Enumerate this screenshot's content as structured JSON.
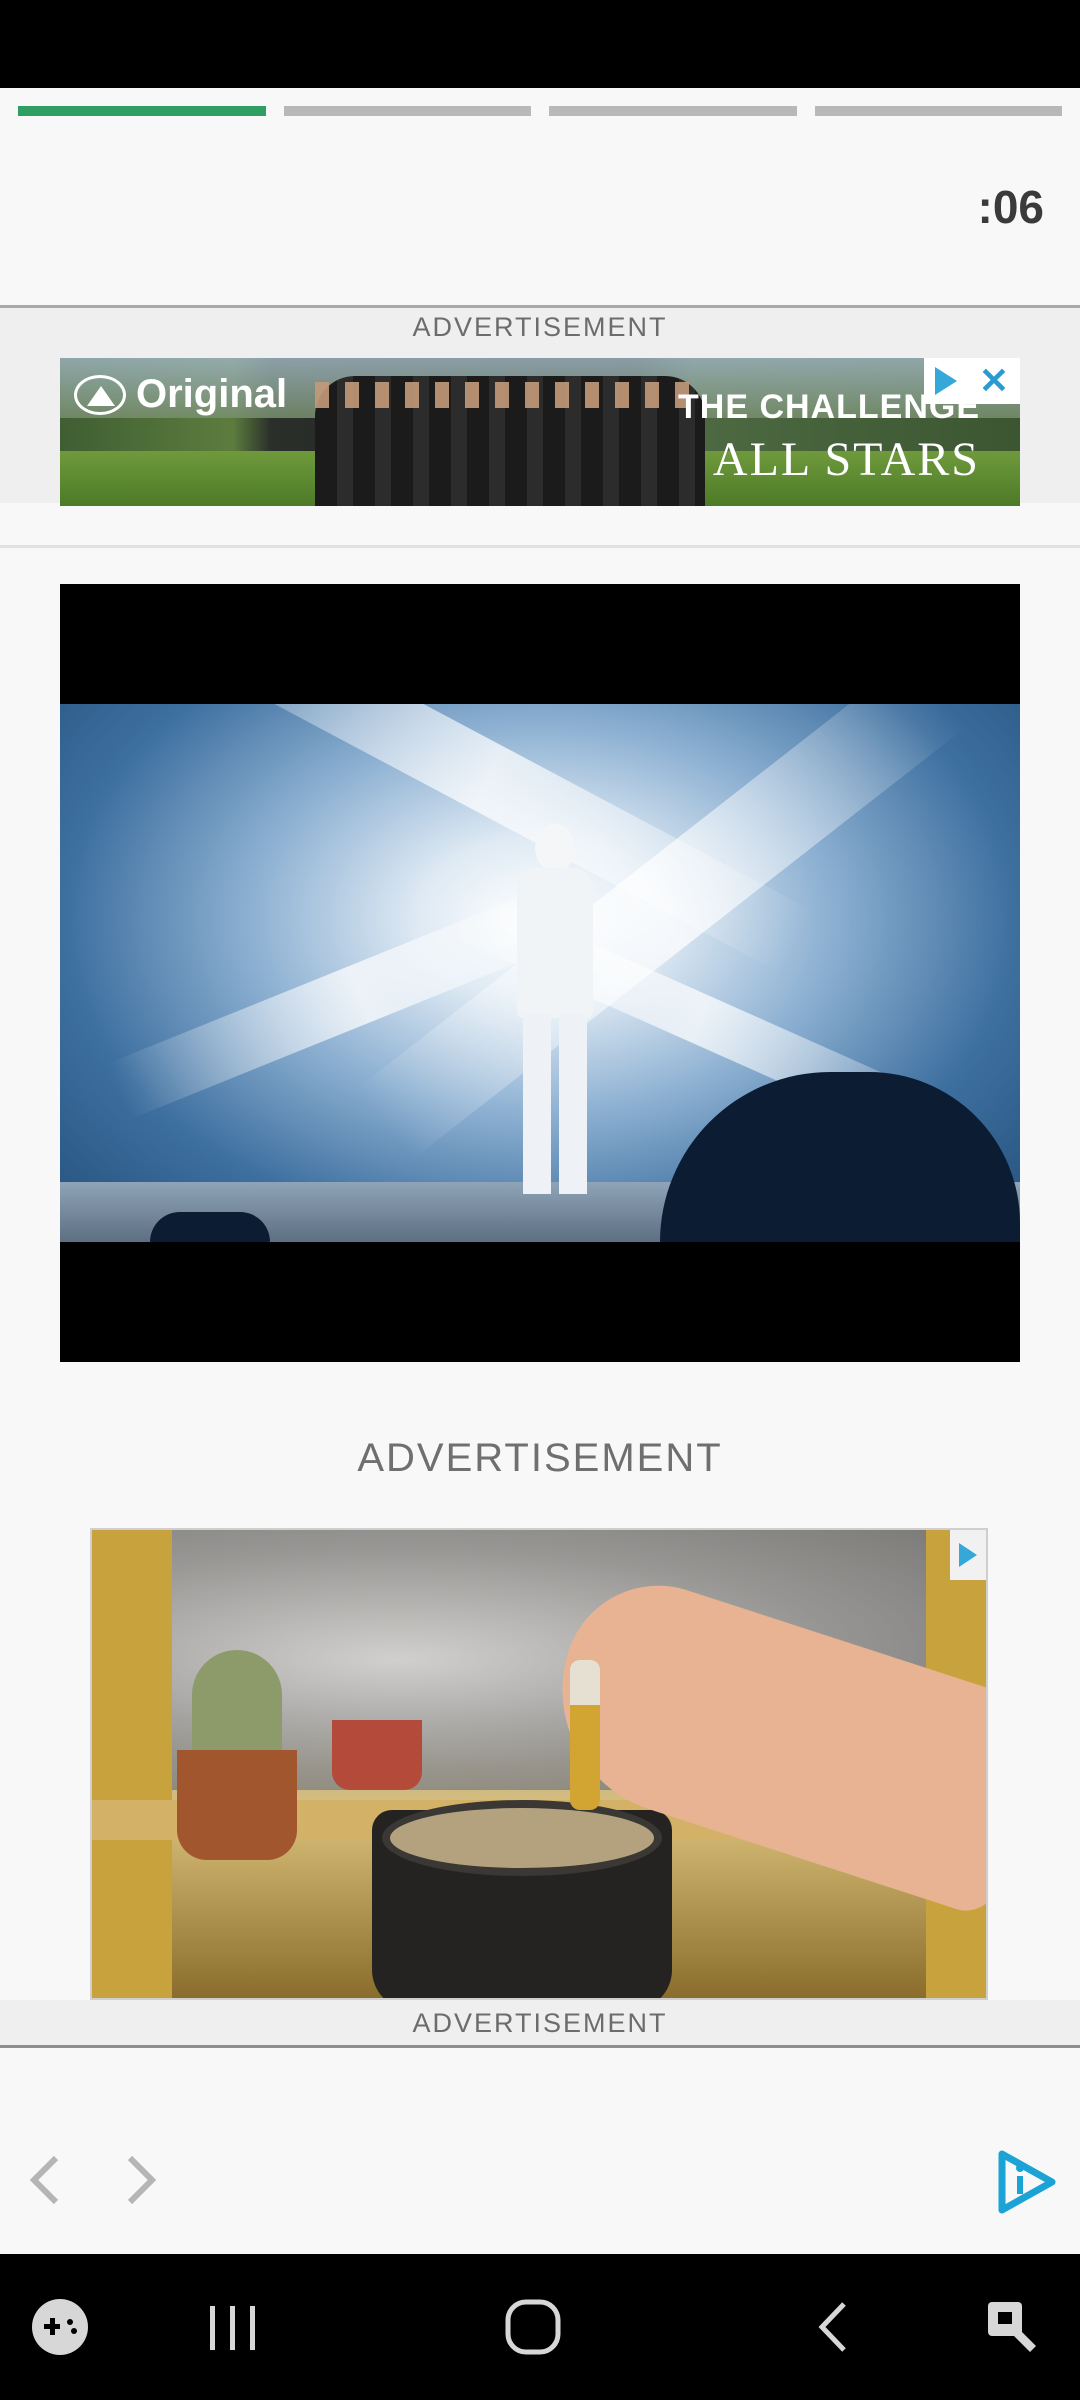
{
  "progress": {
    "segments": 4,
    "active_fraction": [
      1,
      0,
      0,
      0
    ]
  },
  "timer": ":06",
  "top_ad": {
    "label": "ADVERTISEMENT",
    "brand_text": "Original",
    "show_line1": "THE CHALLENGE",
    "show_line2": "ALL STARS"
  },
  "mid_ad": {
    "label": "ADVERTISEMENT"
  },
  "bottom_ad": {
    "label": "ADVERTISEMENT"
  },
  "icons": {
    "prev": "chevron-left-icon",
    "next": "chevron-right-icon",
    "play": "play-icon",
    "adchoices": "adchoices-icon",
    "close": "close-icon"
  },
  "colors": {
    "progress_active": "#2f9e63",
    "progress_inactive": "#b8b8b8",
    "accent": "#1aa3d4"
  }
}
